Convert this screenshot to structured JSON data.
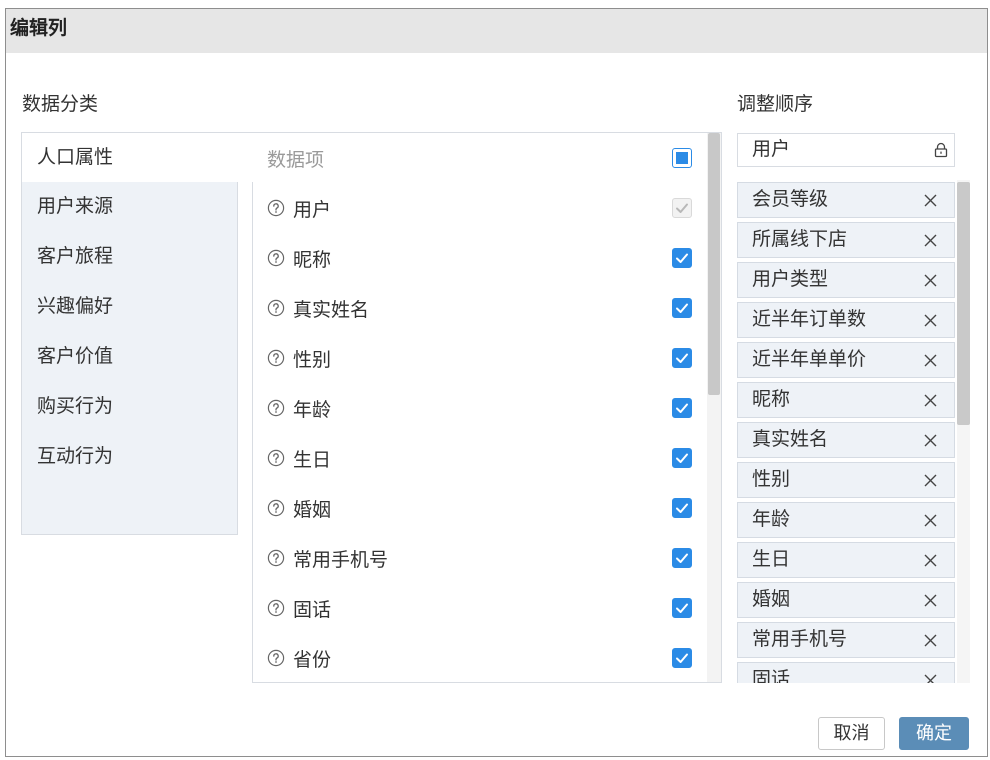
{
  "dialog": {
    "title": "编辑列"
  },
  "categories": {
    "label": "数据分类",
    "items": [
      {
        "label": "人口属性",
        "selected": true
      },
      {
        "label": "用户来源",
        "selected": false
      },
      {
        "label": "客户旅程",
        "selected": false
      },
      {
        "label": "兴趣偏好",
        "selected": false
      },
      {
        "label": "客户价值",
        "selected": false
      },
      {
        "label": "购买行为",
        "selected": false
      },
      {
        "label": "互动行为",
        "selected": false
      }
    ]
  },
  "data_items": {
    "header": "数据项",
    "select_all": {
      "checked": false,
      "indeterminate": true
    },
    "help_icon": "question-circle-icon",
    "items": [
      {
        "label": "用户",
        "checked": true,
        "disabled": true
      },
      {
        "label": "昵称",
        "checked": true,
        "disabled": false
      },
      {
        "label": "真实姓名",
        "checked": true,
        "disabled": false
      },
      {
        "label": "性别",
        "checked": true,
        "disabled": false
      },
      {
        "label": "年龄",
        "checked": true,
        "disabled": false
      },
      {
        "label": "生日",
        "checked": true,
        "disabled": false
      },
      {
        "label": "婚姻",
        "checked": true,
        "disabled": false
      },
      {
        "label": "常用手机号",
        "checked": true,
        "disabled": false
      },
      {
        "label": "固话",
        "checked": true,
        "disabled": false
      },
      {
        "label": "省份",
        "checked": true,
        "disabled": false
      }
    ]
  },
  "order": {
    "label": "调整顺序",
    "locked_item": {
      "label": "用户",
      "icon": "lock-icon"
    },
    "remove_icon": "close-icon",
    "items": [
      "会员等级",
      "所属线下店",
      "用户类型",
      "近半年订单数",
      "近半年单单价",
      "昵称",
      "真实姓名",
      "性别",
      "年龄",
      "生日",
      "婚姻",
      "常用手机号",
      "固话"
    ]
  },
  "buttons": {
    "cancel": "取消",
    "confirm": "确定"
  },
  "colors": {
    "accent": "#2b8be6",
    "confirm_button": "#5b8db7",
    "panel_bg": "#eef2f7",
    "title_bar_bg": "#e6e6e6"
  }
}
